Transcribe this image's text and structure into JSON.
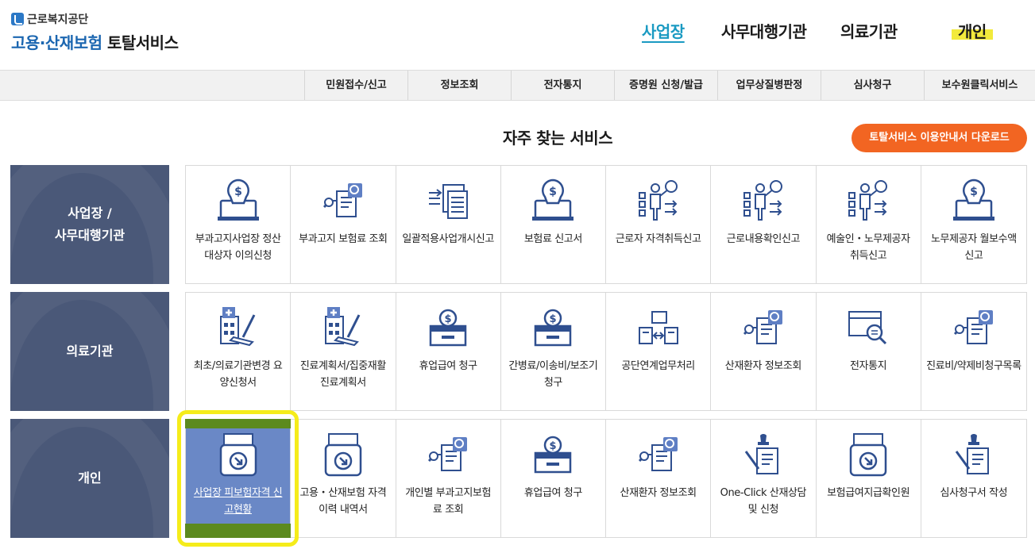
{
  "logo": {
    "org": "근로복지공단",
    "title_blue": "고용·산재보험",
    "title_dark": "토탈서비스"
  },
  "topnav": [
    "사업장",
    "사무대행기관",
    "의료기관",
    "개인"
  ],
  "subnav": [
    "민원접수/신고",
    "정보조회",
    "전자통지",
    "증명원 신청/발급",
    "업무상질병판정",
    "심사청구",
    "보수원클릭서비스"
  ],
  "section_title": "자주 찾는 서비스",
  "download_button": "토탈서비스 이용안내서 다운로드",
  "categories": [
    {
      "label_1": "사업장 /",
      "label_2": "사무대행기관"
    },
    {
      "label_1": "의료기관",
      "label_2": ""
    },
    {
      "label_1": "개인",
      "label_2": ""
    }
  ],
  "rows": [
    [
      {
        "icon": "monitor-dollar-icon",
        "label": "부과고지사업장 정산대상자 이의신청"
      },
      {
        "icon": "document-search-icon",
        "label": "부과고지 보험료 조회"
      },
      {
        "icon": "documents-list-icon",
        "label": "일괄적용사업개시신고"
      },
      {
        "icon": "monitor-dollar-icon",
        "label": "보험료 신고서"
      },
      {
        "icon": "presenter-chart-icon",
        "label": "근로자 자격취득신고"
      },
      {
        "icon": "presenter-chart-icon",
        "label": "근로내용확인신고"
      },
      {
        "icon": "presenter-chart-icon",
        "label": "예술인・노무제공자 취득신고"
      },
      {
        "icon": "monitor-dollar-icon",
        "label": "노무제공자 월보수액 신고"
      }
    ],
    [
      {
        "icon": "hospital-sign-icon",
        "label": "최초/의료기관변경 요양신청서"
      },
      {
        "icon": "hospital-sign-icon",
        "label": "진료계획서/집중재활진료계획서"
      },
      {
        "icon": "cash-box-icon",
        "label": "휴업급여 청구"
      },
      {
        "icon": "cash-box-icon",
        "label": "간병료/이송비/보조기 청구"
      },
      {
        "icon": "document-exchange-icon",
        "label": "공단연계업무처리"
      },
      {
        "icon": "document-search-icon",
        "label": "산재환자 정보조회"
      },
      {
        "icon": "box-magnifier-icon",
        "label": "전자통지"
      },
      {
        "icon": "document-search-icon",
        "label": "진료비/약제비청구목록"
      }
    ],
    [
      {
        "icon": "printer-download-icon",
        "label": "사업장 피보험자격 신고현황"
      },
      {
        "icon": "printer-download-icon",
        "label": "고용・산재보험 자격 이력 내역서"
      },
      {
        "icon": "document-search-icon",
        "label": "개인별 부과고지보험료 조회"
      },
      {
        "icon": "cash-box-icon",
        "label": "휴업급여 청구"
      },
      {
        "icon": "document-search-icon",
        "label": "산재환자 정보조회"
      },
      {
        "icon": "stamp-pen-icon",
        "label": "One-Click 산재상담 및 신청"
      },
      {
        "icon": "printer-download-icon",
        "label": "보험급여지급확인원"
      },
      {
        "icon": "stamp-pen-icon",
        "label": "심사청구서 작성"
      }
    ]
  ],
  "colors": {
    "accent": "#1a9ac2",
    "orange": "#f26522",
    "category_bg": "#4a5878",
    "selected_cell": "#6a88c6",
    "icon_blue": "#2f4f8f"
  }
}
